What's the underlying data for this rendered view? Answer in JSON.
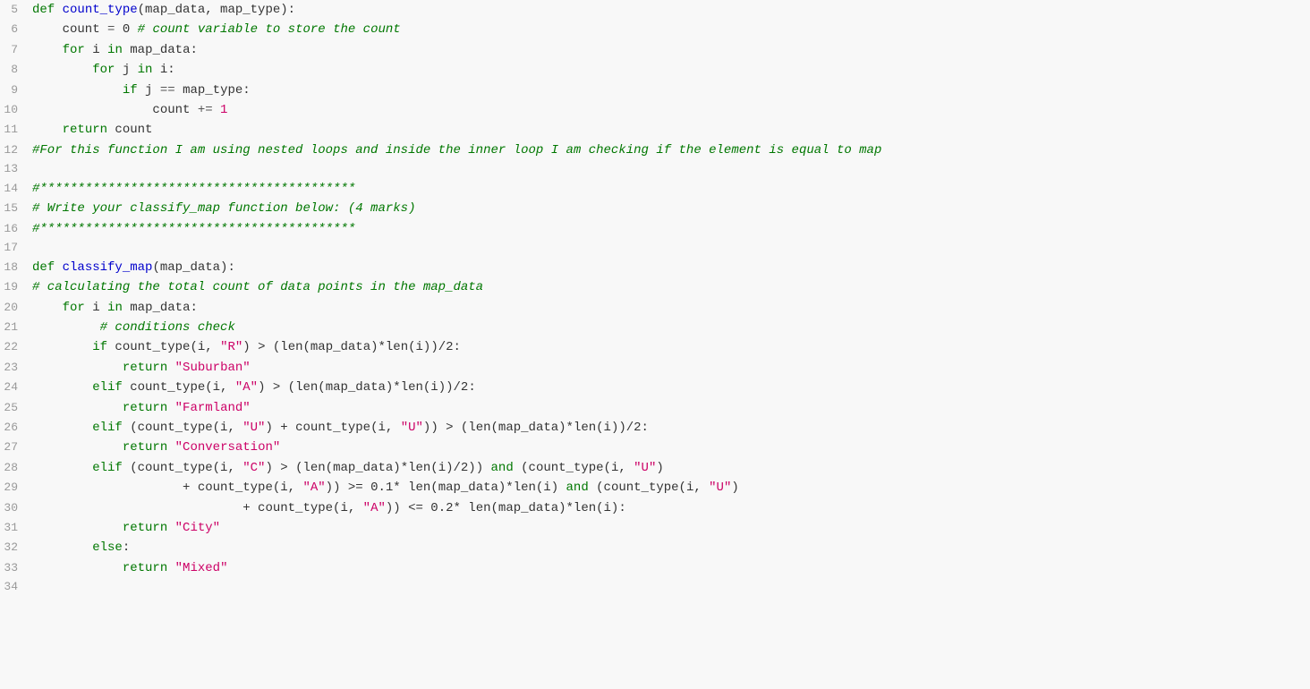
{
  "lines": [
    {
      "num": 5,
      "tokens": [
        {
          "t": "def ",
          "c": "kw"
        },
        {
          "t": "count_type",
          "c": "fn"
        },
        {
          "t": "(map_data, map_type):",
          "c": "plain"
        }
      ]
    },
    {
      "num": 6,
      "tokens": [
        {
          "t": "    count ",
          "c": "plain"
        },
        {
          "t": "=",
          "c": "op"
        },
        {
          "t": " 0 ",
          "c": "plain"
        },
        {
          "t": "# count variable to store the count",
          "c": "comment"
        }
      ]
    },
    {
      "num": 7,
      "tokens": [
        {
          "t": "    ",
          "c": "plain"
        },
        {
          "t": "for",
          "c": "kw"
        },
        {
          "t": " i ",
          "c": "plain"
        },
        {
          "t": "in",
          "c": "kw"
        },
        {
          "t": " map_data:",
          "c": "plain"
        }
      ]
    },
    {
      "num": 8,
      "tokens": [
        {
          "t": "        ",
          "c": "plain"
        },
        {
          "t": "for",
          "c": "kw"
        },
        {
          "t": " j ",
          "c": "plain"
        },
        {
          "t": "in",
          "c": "kw"
        },
        {
          "t": " i:",
          "c": "plain"
        }
      ]
    },
    {
      "num": 9,
      "tokens": [
        {
          "t": "            ",
          "c": "plain"
        },
        {
          "t": "if",
          "c": "kw"
        },
        {
          "t": " j ",
          "c": "plain"
        },
        {
          "t": "==",
          "c": "op"
        },
        {
          "t": " map_type:",
          "c": "plain"
        }
      ]
    },
    {
      "num": 10,
      "tokens": [
        {
          "t": "                count ",
          "c": "plain"
        },
        {
          "t": "+=",
          "c": "op"
        },
        {
          "t": " 1",
          "c": "num"
        }
      ]
    },
    {
      "num": 11,
      "tokens": [
        {
          "t": "    ",
          "c": "plain"
        },
        {
          "t": "return",
          "c": "kw"
        },
        {
          "t": " count",
          "c": "plain"
        }
      ]
    },
    {
      "num": 12,
      "tokens": [
        {
          "t": "#For this function I am using nested loops and inside the inner loop I am checking if the element is equal to map",
          "c": "hash-comment"
        }
      ]
    },
    {
      "num": 13,
      "tokens": []
    },
    {
      "num": 14,
      "tokens": [
        {
          "t": "#******************************************",
          "c": "hash-comment"
        }
      ]
    },
    {
      "num": 15,
      "tokens": [
        {
          "t": "# Write your classify_map function below: (4 marks)",
          "c": "hash-comment"
        }
      ]
    },
    {
      "num": 16,
      "tokens": [
        {
          "t": "#******************************************",
          "c": "hash-comment"
        }
      ]
    },
    {
      "num": 17,
      "tokens": []
    },
    {
      "num": 18,
      "tokens": [
        {
          "t": "def ",
          "c": "kw"
        },
        {
          "t": "classify_map",
          "c": "fn"
        },
        {
          "t": "(map_data):",
          "c": "plain"
        }
      ]
    },
    {
      "num": 19,
      "tokens": [
        {
          "t": "# calculating the total count of data points in the map_data",
          "c": "hash-comment"
        }
      ]
    },
    {
      "num": 20,
      "tokens": [
        {
          "t": "    ",
          "c": "plain"
        },
        {
          "t": "for",
          "c": "kw"
        },
        {
          "t": " i ",
          "c": "plain"
        },
        {
          "t": "in",
          "c": "kw"
        },
        {
          "t": " map_data:",
          "c": "plain"
        }
      ]
    },
    {
      "num": 21,
      "tokens": [
        {
          "t": "         ",
          "c": "plain"
        },
        {
          "t": "# conditions check",
          "c": "hash-comment"
        }
      ]
    },
    {
      "num": 22,
      "tokens": [
        {
          "t": "        ",
          "c": "plain"
        },
        {
          "t": "if",
          "c": "kw"
        },
        {
          "t": " count_type(i, ",
          "c": "plain"
        },
        {
          "t": "\"R\"",
          "c": "string"
        },
        {
          "t": ") > (len(map_data)*len(i))/2:",
          "c": "plain"
        }
      ]
    },
    {
      "num": 23,
      "tokens": [
        {
          "t": "            ",
          "c": "plain"
        },
        {
          "t": "return",
          "c": "kw"
        },
        {
          "t": " ",
          "c": "plain"
        },
        {
          "t": "\"Suburban\"",
          "c": "string"
        }
      ]
    },
    {
      "num": 24,
      "tokens": [
        {
          "t": "        ",
          "c": "plain"
        },
        {
          "t": "elif",
          "c": "kw"
        },
        {
          "t": " count_type(i, ",
          "c": "plain"
        },
        {
          "t": "\"A\"",
          "c": "string"
        },
        {
          "t": ") > (len(map_data)*len(i))/2:",
          "c": "plain"
        }
      ]
    },
    {
      "num": 25,
      "tokens": [
        {
          "t": "            ",
          "c": "plain"
        },
        {
          "t": "return",
          "c": "kw"
        },
        {
          "t": " ",
          "c": "plain"
        },
        {
          "t": "\"Farmland\"",
          "c": "string"
        }
      ]
    },
    {
      "num": 26,
      "tokens": [
        {
          "t": "        ",
          "c": "plain"
        },
        {
          "t": "elif",
          "c": "kw"
        },
        {
          "t": " (count_type(i, ",
          "c": "plain"
        },
        {
          "t": "\"U\"",
          "c": "string"
        },
        {
          "t": ") + count_type(i, ",
          "c": "plain"
        },
        {
          "t": "\"U\"",
          "c": "string"
        },
        {
          "t": ")) > (len(map_data)*len(i))/2:",
          "c": "plain"
        }
      ]
    },
    {
      "num": 27,
      "tokens": [
        {
          "t": "            ",
          "c": "plain"
        },
        {
          "t": "return",
          "c": "kw"
        },
        {
          "t": " ",
          "c": "plain"
        },
        {
          "t": "\"Conversation\"",
          "c": "string"
        }
      ]
    },
    {
      "num": 28,
      "tokens": [
        {
          "t": "        ",
          "c": "plain"
        },
        {
          "t": "elif",
          "c": "kw"
        },
        {
          "t": " (count_type(i, ",
          "c": "plain"
        },
        {
          "t": "\"C\"",
          "c": "string"
        },
        {
          "t": ") > (len(map_data)*len(i)/2)) ",
          "c": "plain"
        },
        {
          "t": "and",
          "c": "kw"
        },
        {
          "t": " (count_type(i, ",
          "c": "plain"
        },
        {
          "t": "\"U\"",
          "c": "string"
        },
        {
          "t": ")",
          "c": "plain"
        }
      ]
    },
    {
      "num": 29,
      "tokens": [
        {
          "t": "                    + count_type(i, ",
          "c": "plain"
        },
        {
          "t": "\"A\"",
          "c": "string"
        },
        {
          "t": ")) >= 0.1* len(map_data)*len(i) ",
          "c": "plain"
        },
        {
          "t": "and",
          "c": "kw"
        },
        {
          "t": " (count_type(i, ",
          "c": "plain"
        },
        {
          "t": "\"U\"",
          "c": "string"
        },
        {
          "t": ")",
          "c": "plain"
        }
      ]
    },
    {
      "num": 30,
      "tokens": [
        {
          "t": "                            + count_type(i, ",
          "c": "plain"
        },
        {
          "t": "\"A\"",
          "c": "string"
        },
        {
          "t": ")) <= 0.2* len(map_data)*len(i):",
          "c": "plain"
        }
      ]
    },
    {
      "num": 31,
      "tokens": [
        {
          "t": "            ",
          "c": "plain"
        },
        {
          "t": "return",
          "c": "kw"
        },
        {
          "t": " ",
          "c": "plain"
        },
        {
          "t": "\"City\"",
          "c": "string"
        }
      ]
    },
    {
      "num": 32,
      "tokens": [
        {
          "t": "        ",
          "c": "plain"
        },
        {
          "t": "else",
          "c": "kw"
        },
        {
          "t": ":",
          "c": "plain"
        }
      ]
    },
    {
      "num": 33,
      "tokens": [
        {
          "t": "            ",
          "c": "plain"
        },
        {
          "t": "return",
          "c": "kw"
        },
        {
          "t": " ",
          "c": "plain"
        },
        {
          "t": "\"Mixed\"",
          "c": "string"
        }
      ]
    },
    {
      "num": 34,
      "tokens": []
    }
  ]
}
